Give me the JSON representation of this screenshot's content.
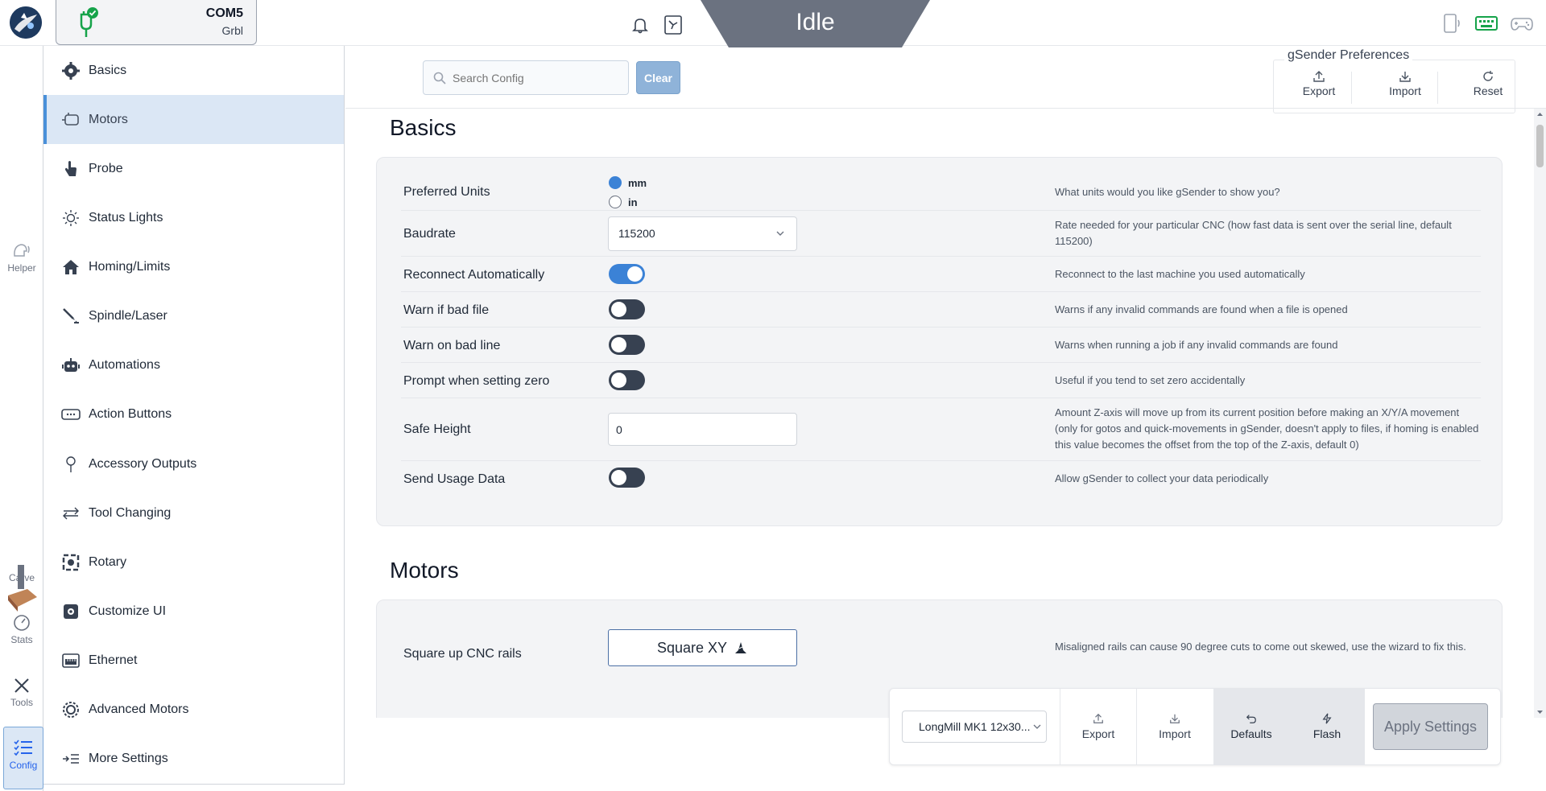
{
  "topbar": {
    "port": "COM5",
    "firmware": "Grbl",
    "machine_state": "Idle"
  },
  "rail": {
    "helper": "Helper",
    "carve": "Carve",
    "stats": "Stats",
    "tools": "Tools",
    "config": "Config"
  },
  "sidebar": {
    "items": [
      {
        "label": "Basics",
        "icon": "gear-icon"
      },
      {
        "label": "Motors",
        "icon": "motor-icon"
      },
      {
        "label": "Probe",
        "icon": "hand-pointer-icon"
      },
      {
        "label": "Status Lights",
        "icon": "sun-icon"
      },
      {
        "label": "Homing/Limits",
        "icon": "home-icon"
      },
      {
        "label": "Spindle/Laser",
        "icon": "laser-icon"
      },
      {
        "label": "Automations",
        "icon": "robot-icon"
      },
      {
        "label": "Action Buttons",
        "icon": "button-icon"
      },
      {
        "label": "Accessory Outputs",
        "icon": "pin-icon"
      },
      {
        "label": "Tool Changing",
        "icon": "swap-arrows-icon"
      },
      {
        "label": "Rotary",
        "icon": "rotary-icon"
      },
      {
        "label": "Customize UI",
        "icon": "palette-icon"
      },
      {
        "label": "Ethernet",
        "icon": "ethernet-icon"
      },
      {
        "label": "Advanced Motors",
        "icon": "advanced-gear-icon"
      },
      {
        "label": "More Settings",
        "icon": "indent-list-icon"
      }
    ],
    "active_index": 1
  },
  "search": {
    "placeholder": "Search Config",
    "value": "",
    "clear_label": "Clear"
  },
  "prefs": {
    "title": "gSender Preferences",
    "export_label": "Export",
    "import_label": "Import",
    "reset_label": "Reset"
  },
  "basics": {
    "title": "Basics",
    "rows": {
      "units": {
        "label": "Preferred Units",
        "options": [
          "mm",
          "in"
        ],
        "selected": "mm",
        "desc": "What units would you like gSender to show you?"
      },
      "baudrate": {
        "label": "Baudrate",
        "value": "115200",
        "desc": "Rate needed for your particular CNC (how fast data is sent over the serial line, default 115200)"
      },
      "reconnect": {
        "label": "Reconnect Automatically",
        "on": true,
        "desc": "Reconnect to the last machine you used automatically"
      },
      "warn_file": {
        "label": "Warn if bad file",
        "on": false,
        "desc": "Warns if any invalid commands are found when a file is opened"
      },
      "warn_line": {
        "label": "Warn on bad line",
        "on": false,
        "desc": "Warns when running a job if any invalid commands are found"
      },
      "prompt_zero": {
        "label": "Prompt when setting zero",
        "on": false,
        "desc": "Useful if you tend to set zero accidentally"
      },
      "safe_height": {
        "label": "Safe Height",
        "value": "0",
        "desc": "Amount Z-axis will move up from its current position before making an X/Y/A movement (only for gotos and quick-movements in gSender, doesn't apply to files, if homing is enabled this value becomes the offset from the top of the Z-axis, default 0)"
      },
      "usage": {
        "label": "Send Usage Data",
        "on": false,
        "desc": "Allow gSender to collect your data periodically"
      }
    }
  },
  "motors": {
    "title": "Motors",
    "rows": {
      "square": {
        "label": "Square up CNC rails",
        "button": "Square XY",
        "desc": "Misaligned rails can cause 90 degree cuts to come out skewed, use the wizard to fix this."
      }
    }
  },
  "actionbar": {
    "profile": "LongMill MK1 12x30...",
    "export_label": "Export",
    "import_label": "Import",
    "defaults_label": "Defaults",
    "flash_label": "Flash",
    "apply_label": "Apply Settings"
  },
  "colors": {
    "accent": "#3b82d6",
    "active_bg": "#dbe7f5",
    "state_bg": "#6b7280",
    "card_bg": "#f3f4f6"
  }
}
